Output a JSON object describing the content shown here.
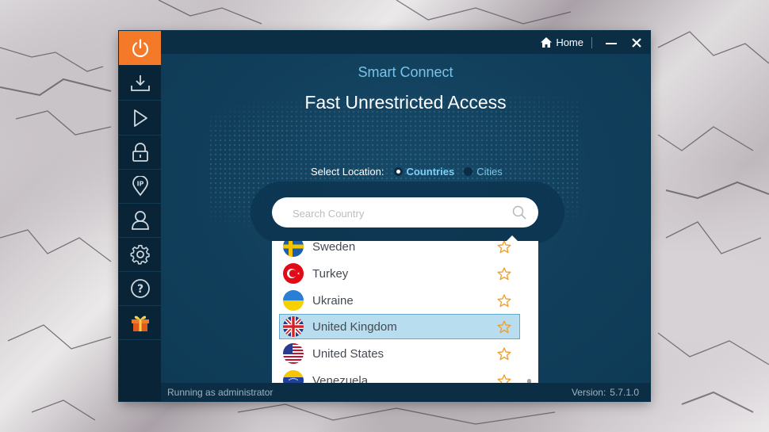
{
  "titlebar": {
    "home_label": "Home"
  },
  "sidebar": {
    "items": [
      {
        "icon": "power-icon"
      },
      {
        "icon": "download-icon"
      },
      {
        "icon": "play-icon"
      },
      {
        "icon": "lock-icon"
      },
      {
        "icon": "ip-location-icon"
      },
      {
        "icon": "user-icon"
      },
      {
        "icon": "gear-icon"
      },
      {
        "icon": "help-icon"
      },
      {
        "icon": "gift-icon"
      }
    ]
  },
  "main": {
    "subtitle": "Smart Connect",
    "headline": "Fast Unrestricted Access",
    "select_location_label": "Select Location:",
    "options": {
      "countries": "Countries",
      "cities": "Cities",
      "selected": "Countries"
    },
    "search": {
      "placeholder": "Search Country",
      "value": ""
    },
    "countries": [
      {
        "name": "Sweden",
        "flag": "sweden-flag-icon",
        "favorite": false,
        "selected": false
      },
      {
        "name": "Turkey",
        "flag": "turkey-flag-icon",
        "favorite": false,
        "selected": false
      },
      {
        "name": "Ukraine",
        "flag": "ukraine-flag-icon",
        "favorite": false,
        "selected": false
      },
      {
        "name": "United Kingdom",
        "flag": "uk-flag-icon",
        "favorite": false,
        "selected": true
      },
      {
        "name": "United States",
        "flag": "us-flag-icon",
        "favorite": false,
        "selected": false
      },
      {
        "name": "Venezuela",
        "flag": "venezuela-flag-icon",
        "favorite": false,
        "selected": false
      }
    ]
  },
  "status": {
    "left": "Running as administrator",
    "version_label": "Version:",
    "version_value": "5.7.1.0"
  },
  "colors": {
    "accent_orange": "#f47a2a",
    "window_bg": "#0f3a55",
    "sidebar_bg": "#0a2437",
    "highlight_blue": "#b8ddef",
    "star_orange": "#f0a030",
    "link_blue": "#7fd0f7"
  }
}
